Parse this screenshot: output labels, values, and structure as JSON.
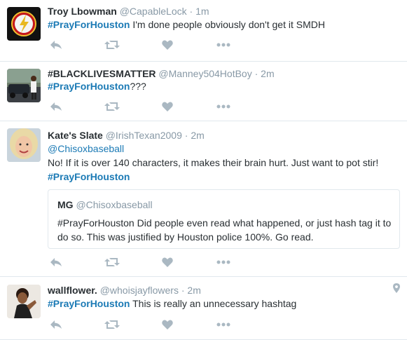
{
  "tweets": [
    {
      "name": "Troy Lbowman",
      "handle": "@CapableLock",
      "time": "1m",
      "hashtag": "#PrayForHouston",
      "text": " I'm done people obviously don't get it SMDH"
    },
    {
      "name": "#BLACKLIVESMATTER",
      "handle": "@Manney504HotBoy",
      "time": "2m",
      "hashtag": "#PrayForHouston",
      "text": "???"
    },
    {
      "name": "Kate's Slate",
      "handle": "@IrishTexan2009",
      "time": "2m",
      "mention": "@Chisoxbaseball",
      "text": "No! If it is over 140 characters, it makes their brain hurt. Just want to pot stir!",
      "hashtag": "#PrayForHouston",
      "quote": {
        "name": "MG",
        "handle": "@Chisoxbaseball",
        "text": "#PrayForHouston Did people even read what happened, or just hash tag it to do so. This was justified by Houston police 100%. Go read."
      }
    },
    {
      "name": "wallflower.",
      "handle": "@whoisjayflowers",
      "time": "2m",
      "hashtag": "#PrayForHouston",
      "text": " This is really an unnecessary hashtag"
    }
  ],
  "separator": "·",
  "icons": {
    "reply": "reply-icon",
    "retweet": "retweet-icon",
    "like": "heart-icon",
    "more": "more-icon",
    "location": "location-pin-icon"
  },
  "colors": {
    "link": "#1b7ab5",
    "muted": "#8899a6",
    "icon": "#aab8c2",
    "border": "#e1e8ed"
  }
}
